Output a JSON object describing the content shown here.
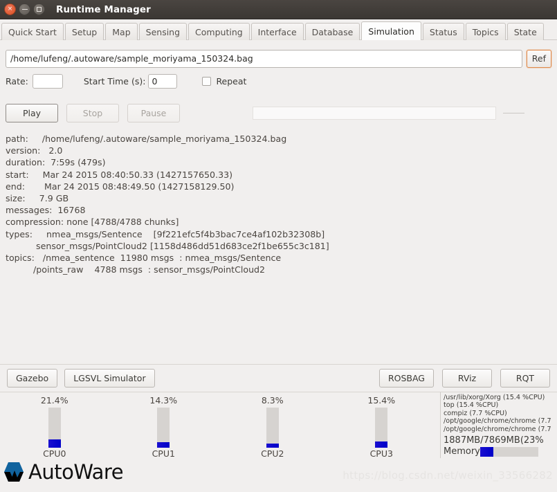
{
  "window": {
    "title": "Runtime Manager",
    "controls": {
      "close": "×",
      "minimize": "–",
      "maximize": "□"
    }
  },
  "tabs": [
    {
      "label": "Quick Start",
      "active": false
    },
    {
      "label": "Setup",
      "active": false
    },
    {
      "label": "Map",
      "active": false
    },
    {
      "label": "Sensing",
      "active": false
    },
    {
      "label": "Computing",
      "active": false
    },
    {
      "label": "Interface",
      "active": false
    },
    {
      "label": "Database",
      "active": false
    },
    {
      "label": "Simulation",
      "active": true
    },
    {
      "label": "Status",
      "active": false
    },
    {
      "label": "Topics",
      "active": false
    },
    {
      "label": "State",
      "active": false
    }
  ],
  "simulation": {
    "bag_path_value": "/home/lufeng/.autoware/sample_moriyama_150324.bag",
    "ref_button": "Ref",
    "rate_label": "Rate:",
    "rate_value": "",
    "start_time_label": "Start Time (s):",
    "start_time_value": "0",
    "repeat_label": "Repeat",
    "play_button": "Play",
    "stop_button": "Stop",
    "pause_button": "Pause",
    "info": "path:     /home/lufeng/.autoware/sample_moriyama_150324.bag\nversion:   2.0\nduration:  7:59s (479s)\nstart:     Mar 24 2015 08:40:50.33 (1427157650.33)\nend:       Mar 24 2015 08:48:49.50 (1427158129.50)\nsize:     7.9 GB\nmessages:  16768\ncompression: none [4788/4788 chunks]\ntypes:     nmea_msgs/Sentence    [9f221efc5f4b3bac7ce4af102b32308b]\n           sensor_msgs/PointCloud2 [1158d486dd51d683ce2f1be655c3c181]\ntopics:   /nmea_sentence  11980 msgs  : nmea_msgs/Sentence\n          /points_raw    4788 msgs  : sensor_msgs/PointCloud2"
  },
  "bottom_buttons": {
    "left": [
      {
        "label": "Gazebo"
      },
      {
        "label": "LGSVL Simulator"
      }
    ],
    "right": [
      {
        "label": "ROSBAG"
      },
      {
        "label": "RViz"
      },
      {
        "label": "RQT"
      }
    ]
  },
  "monitor": {
    "cpus": [
      {
        "name": "CPU0",
        "percent": "21.4%",
        "value": 21.4
      },
      {
        "name": "CPU1",
        "percent": "14.3%",
        "value": 14.3
      },
      {
        "name": "CPU2",
        "percent": "8.3%",
        "value": 8.3
      },
      {
        "name": "CPU3",
        "percent": "15.4%",
        "value": 15.4
      }
    ],
    "processes": [
      "/usr/lib/xorg/Xorg (15.4 %CPU)",
      "top (15.4 %CPU)",
      "compiz (7.7 %CPU)",
      "/opt/google/chrome/chrome (7.7",
      "/opt/google/chrome/chrome (7.7"
    ],
    "memory_text": "1887MB/7869MB(23%",
    "memory_label": "Memory",
    "memory_percent": 23,
    "bar_color": "#0000c8"
  },
  "footer": {
    "logo_text": "AutoWare",
    "logo_color": "#11639e",
    "watermark": "https://blog.csdn.net/weixin_33566282"
  }
}
